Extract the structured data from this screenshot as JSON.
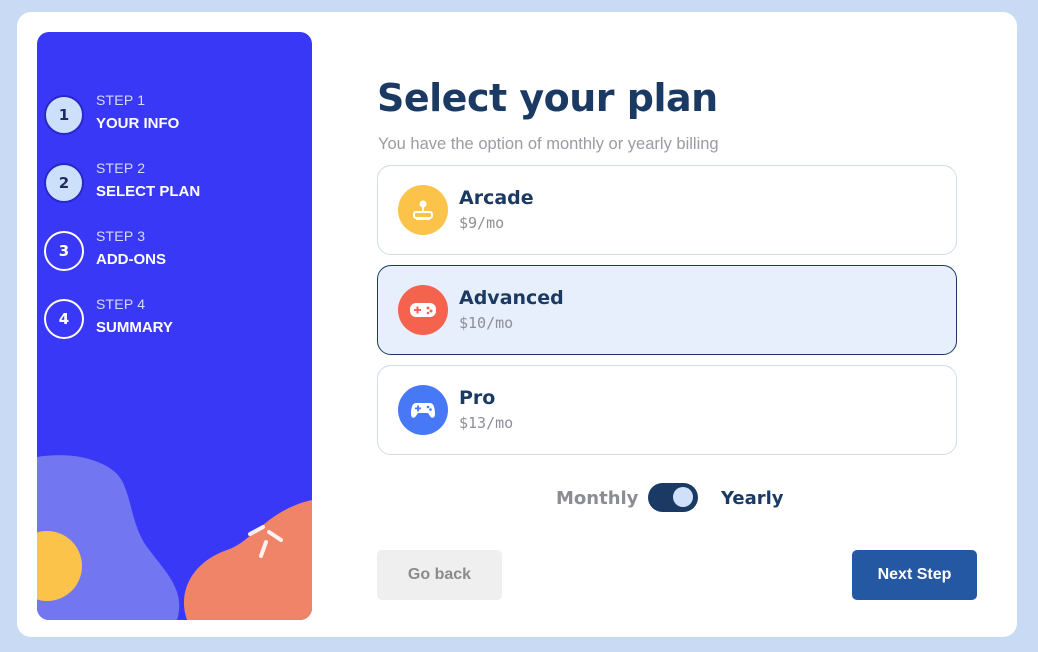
{
  "steps": [
    {
      "number": "1",
      "step_label": "STEP 1",
      "title": "YOUR INFO",
      "active": true
    },
    {
      "number": "2",
      "step_label": "STEP 2",
      "title": "SELECT PLAN",
      "active": true
    },
    {
      "number": "3",
      "step_label": "STEP 3",
      "title": "ADD-ONS",
      "active": false
    },
    {
      "number": "4",
      "step_label": "STEP 4",
      "title": "SUMMARY",
      "active": false
    }
  ],
  "main": {
    "title": "Select your plan",
    "subtitle": "You have the option of monthly or yearly billing"
  },
  "plans": [
    {
      "name": "Arcade",
      "price": "$9/mo",
      "icon": "arcade-joystick-icon",
      "color": "#fcc34a",
      "selected": false
    },
    {
      "name": "Advanced",
      "price": "$10/mo",
      "icon": "gamepad-icon",
      "color": "#f5624e",
      "selected": true
    },
    {
      "name": "Pro",
      "price": "$13/mo",
      "icon": "controller-icon",
      "color": "#4778f5",
      "selected": false
    }
  ],
  "billing": {
    "monthly_label": "Monthly",
    "yearly_label": "Yearly",
    "selected": "Yearly"
  },
  "buttons": {
    "back_label": "Go back",
    "next_label": "Next Step"
  },
  "colors": {
    "sidebar": "#3a38f7",
    "primary": "#1b3a63",
    "next_button": "#2558a3"
  }
}
